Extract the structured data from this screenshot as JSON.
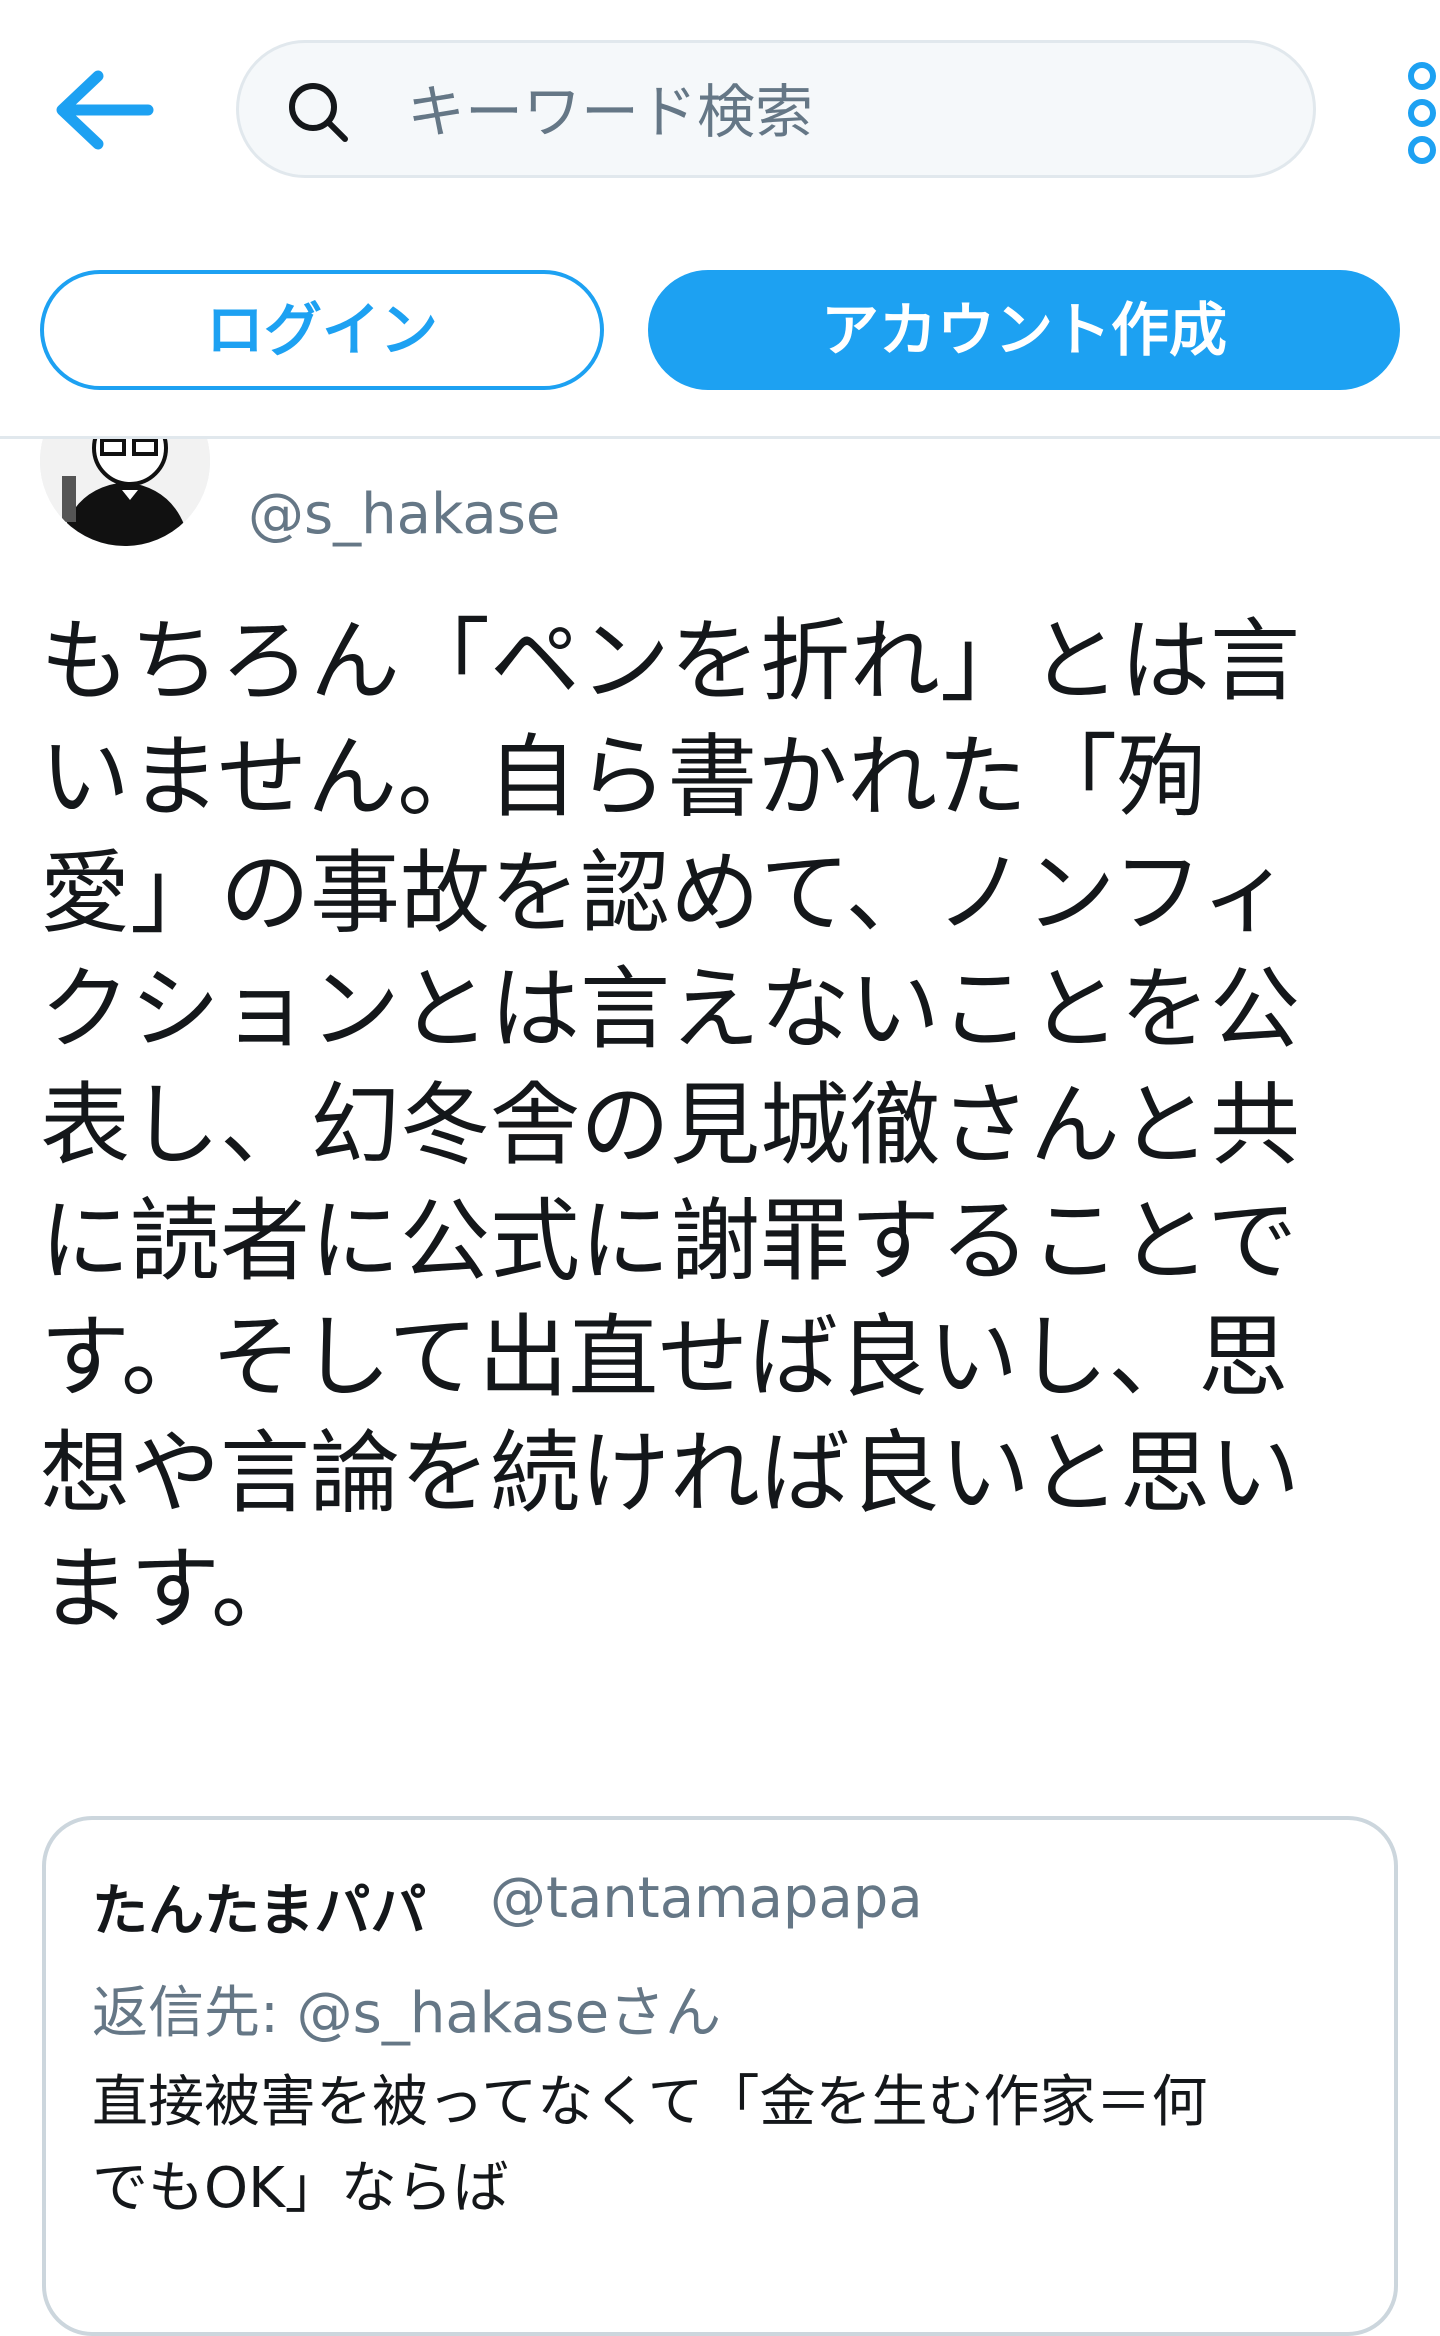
{
  "header": {
    "search_placeholder": "キーワード検索",
    "login_label": "ログイン",
    "signup_label": "アカウント作成",
    "accent": "#1da1f2"
  },
  "tweet": {
    "handle": "@s_hakase",
    "text": "もちろん「ペンを折れ」とは言\nいません。自ら書かれた「殉\n愛」の事故を認めて、ノンフィ\nクションとは言えないことを公\n表し、幻冬舎の見城徹さんと共\nに読者に公式に謝罪することで\nす。そして出直せば良いし、思\n想や言論を続ければ良いと思い\nます。"
  },
  "quoted_tweet": {
    "name": "たんたまパパ",
    "handle": "@tantamapapa",
    "reply_to": "返信先: @s_hakaseさん",
    "text": "直接被害を被ってなくて「金を生む作家＝何\nでもOK」ならば"
  }
}
